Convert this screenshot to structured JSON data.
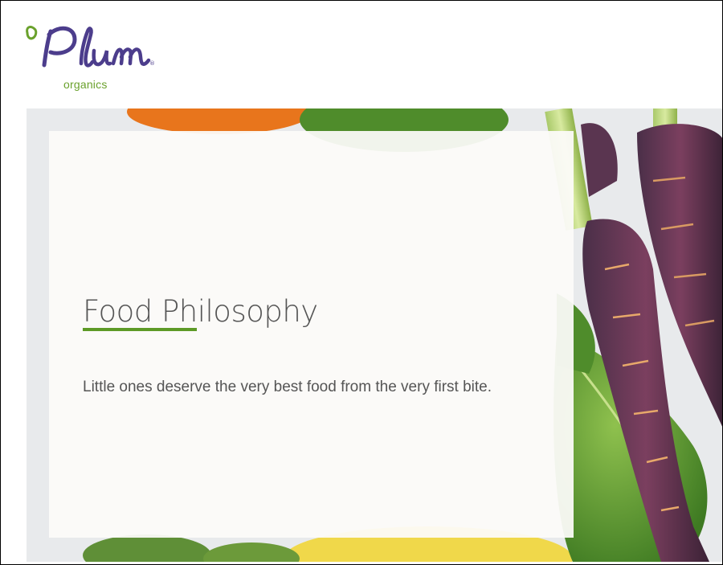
{
  "brand": {
    "logo_text": "Plum",
    "logo_sub": "organics",
    "colors": {
      "logo_purple": "#4c3d8c",
      "logo_green": "#6aa12c"
    }
  },
  "hero": {
    "title": "Food Philosophy",
    "body": "Little ones deserve the very best food from the very first bite.",
    "accent_color": "#5d9a26"
  }
}
